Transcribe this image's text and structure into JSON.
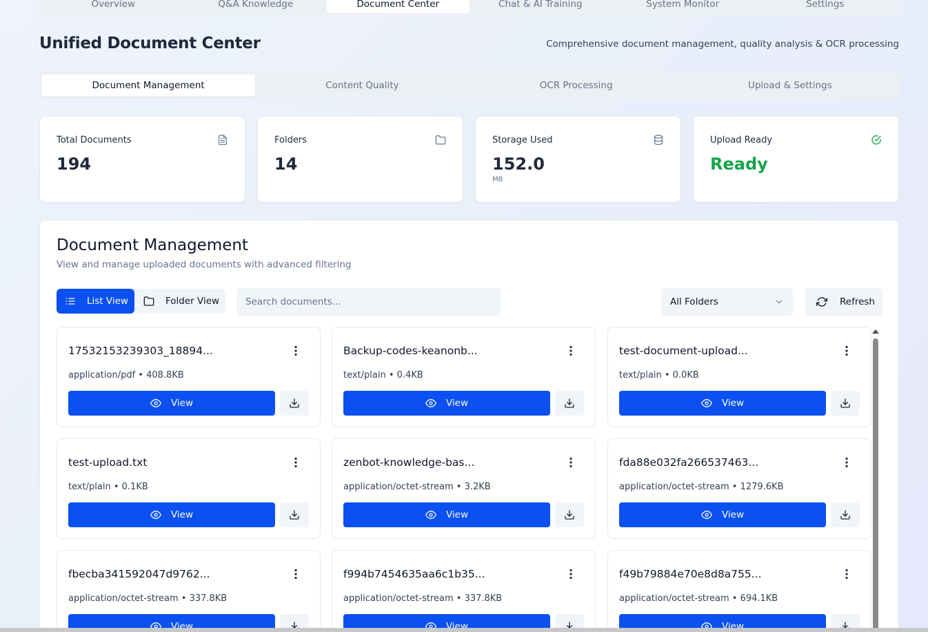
{
  "topnav": {
    "tabs": [
      {
        "label": "Overview",
        "active": false
      },
      {
        "label": "Q&A Knowledge",
        "active": false
      },
      {
        "label": "Document Center",
        "active": true
      },
      {
        "label": "Chat & AI Training",
        "active": false
      },
      {
        "label": "System Monitor",
        "active": false
      },
      {
        "label": "Settings",
        "active": false
      }
    ]
  },
  "header": {
    "title": "Unified Document Center",
    "subtitle": "Comprehensive document management, quality analysis & OCR processing"
  },
  "subtabs": [
    {
      "label": "Document Management",
      "active": true
    },
    {
      "label": "Content Quality",
      "active": false
    },
    {
      "label": "OCR Processing",
      "active": false
    },
    {
      "label": "Upload & Settings",
      "active": false
    }
  ],
  "stats": [
    {
      "label": "Total Documents",
      "value": "194",
      "unit": "",
      "icon": "file-text-icon"
    },
    {
      "label": "Folders",
      "value": "14",
      "unit": "",
      "icon": "folder-icon"
    },
    {
      "label": "Storage Used",
      "value": "152.0",
      "unit": "MB",
      "icon": "database-icon"
    },
    {
      "label": "Upload Ready",
      "value": "Ready",
      "unit": "",
      "icon": "check-circle-icon"
    }
  ],
  "colors": {
    "primary": "#0b50f0",
    "success": "#16a34a"
  },
  "panel": {
    "title": "Document Management",
    "description": "View and manage uploaded documents with advanced filtering",
    "list_view_label": "List View",
    "folder_view_label": "Folder View",
    "search_placeholder": "Search documents...",
    "folder_filter": "All Folders",
    "refresh_label": "Refresh",
    "view_label": "View"
  },
  "documents": [
    {
      "name": "17532153239303_18894...",
      "meta": "application/pdf • 408.8KB"
    },
    {
      "name": "Backup-codes-keanonb...",
      "meta": "text/plain • 0.4KB"
    },
    {
      "name": "test-document-upload...",
      "meta": "text/plain • 0.0KB"
    },
    {
      "name": "test-upload.txt",
      "meta": "text/plain • 0.1KB"
    },
    {
      "name": "zenbot-knowledge-bas...",
      "meta": "application/octet-stream • 3.2KB"
    },
    {
      "name": "fda88e032fa266537463...",
      "meta": "application/octet-stream • 1279.6KB"
    },
    {
      "name": "fbecba341592047d9762...",
      "meta": "application/octet-stream • 337.8KB"
    },
    {
      "name": "f994b7454635aa6c1b35...",
      "meta": "application/octet-stream • 337.8KB"
    },
    {
      "name": "f49b79884e70e8d8a755...",
      "meta": "application/octet-stream • 694.1KB"
    }
  ]
}
